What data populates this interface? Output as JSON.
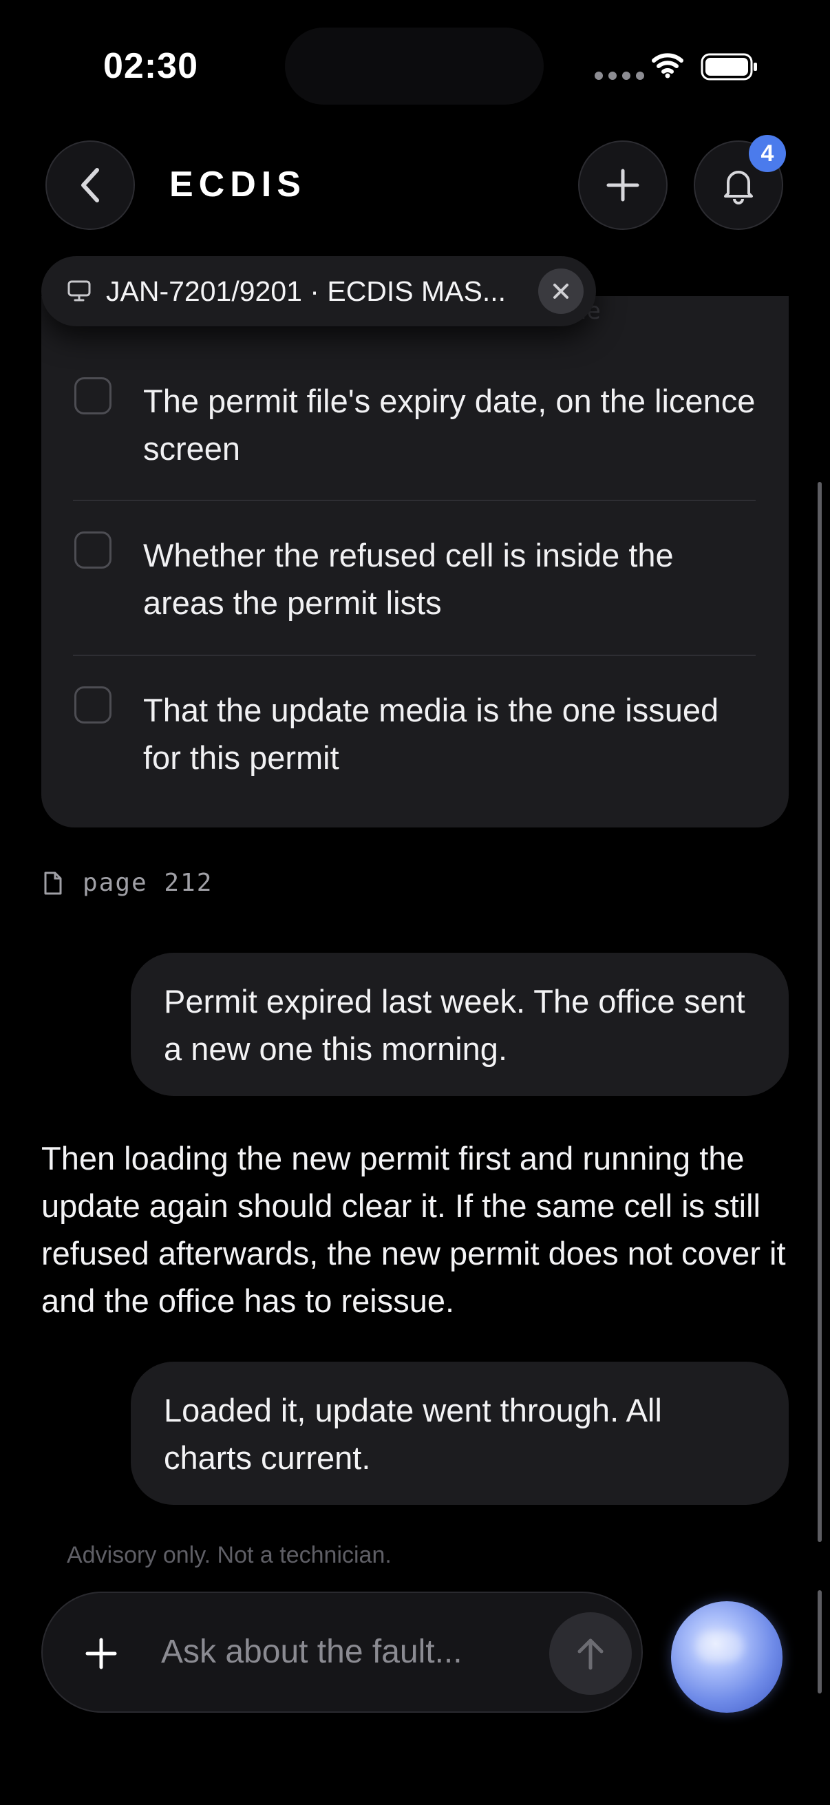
{
  "status_bar": {
    "time": "02:30"
  },
  "header": {
    "title": "ECDIS",
    "notification_count": "4"
  },
  "context_chip": {
    "label": "JAN-7201/9201 · ECDIS MAS..."
  },
  "checklist": {
    "partial_heading": "te",
    "items": [
      {
        "text": "The permit file's expiry date, on the licence screen",
        "checked": false
      },
      {
        "text": "Whether the refused cell is inside the areas the permit lists",
        "checked": false
      },
      {
        "text": "That the update media is the one issued for this permit",
        "checked": false
      }
    ]
  },
  "source": {
    "page": "page 212"
  },
  "messages": [
    {
      "role": "user",
      "text": "Permit expired last week. The office sent a new one this morning."
    },
    {
      "role": "assistant",
      "text": "Then loading the new permit first and running the update again should clear it. If the same cell is still refused afterwards, the new permit does not cover it and the office has to reissue."
    },
    {
      "role": "user",
      "text": "Loaded it, update went through. All charts current."
    }
  ],
  "footer": {
    "disclaimer": "Advisory only. Not a technician.",
    "input_placeholder": "Ask about the fault..."
  },
  "colors": {
    "accent": "#4b7bec",
    "background": "#000000",
    "card": "#1c1c1f"
  }
}
